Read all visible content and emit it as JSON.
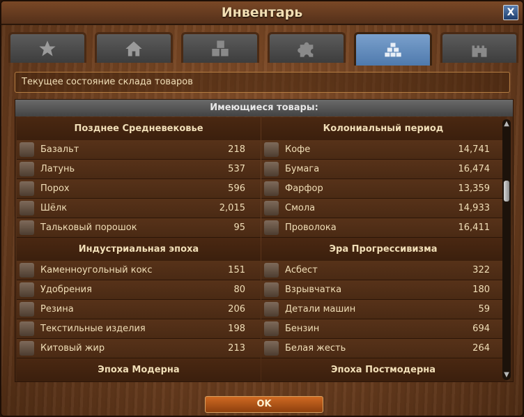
{
  "window": {
    "title": "Инвентарь",
    "close_label": "X"
  },
  "tabs": [
    {
      "icon": "star-icon"
    },
    {
      "icon": "house-icon"
    },
    {
      "icon": "crates-icon"
    },
    {
      "icon": "puzzle-icon"
    },
    {
      "icon": "goods-stack-icon",
      "active": true
    },
    {
      "icon": "castle-icon"
    }
  ],
  "info": "Текущее состояние склада товаров",
  "panel": {
    "header": "Имеющиеся товары:"
  },
  "left_column": {
    "eras": [
      {
        "name": "Позднее Средневековье",
        "items": [
          {
            "name": "Базальт",
            "value": "218",
            "icon": "basalt-icon"
          },
          {
            "name": "Латунь",
            "value": "537",
            "icon": "brass-icon"
          },
          {
            "name": "Порох",
            "value": "596",
            "icon": "gunpowder-icon"
          },
          {
            "name": "Шёлк",
            "value": "2,015",
            "icon": "silk-icon"
          },
          {
            "name": "Тальковый порошок",
            "value": "95",
            "icon": "talc-powder-icon"
          }
        ]
      },
      {
        "name": "Индустриальная эпоха",
        "items": [
          {
            "name": "Каменноугольный кокс",
            "value": "151",
            "icon": "coke-icon"
          },
          {
            "name": "Удобрения",
            "value": "80",
            "icon": "fertilizer-icon"
          },
          {
            "name": "Резина",
            "value": "206",
            "icon": "rubber-icon"
          },
          {
            "name": "Текстильные изделия",
            "value": "198",
            "icon": "textiles-icon"
          },
          {
            "name": "Китовый жир",
            "value": "213",
            "icon": "whale-oil-icon"
          }
        ]
      },
      {
        "name": "Эпоха Модерна",
        "items": []
      }
    ]
  },
  "right_column": {
    "eras": [
      {
        "name": "Колониальный период",
        "items": [
          {
            "name": "Кофе",
            "value": "14,741",
            "icon": "coffee-icon"
          },
          {
            "name": "Бумага",
            "value": "16,474",
            "icon": "paper-icon"
          },
          {
            "name": "Фарфор",
            "value": "13,359",
            "icon": "porcelain-icon"
          },
          {
            "name": "Смола",
            "value": "14,933",
            "icon": "tar-icon"
          },
          {
            "name": "Проволока",
            "value": "16,411",
            "icon": "wire-icon"
          }
        ]
      },
      {
        "name": "Эра Прогрессивизма",
        "items": [
          {
            "name": "Асбест",
            "value": "322",
            "icon": "asbestos-icon"
          },
          {
            "name": "Взрывчатка",
            "value": "180",
            "icon": "explosives-icon"
          },
          {
            "name": "Детали машин",
            "value": "59",
            "icon": "machine-parts-icon"
          },
          {
            "name": "Бензин",
            "value": "694",
            "icon": "petroleum-icon"
          },
          {
            "name": "Белая жесть",
            "value": "264",
            "icon": "tinplate-icon"
          }
        ]
      },
      {
        "name": "Эпоха Постмодерна",
        "items": []
      }
    ]
  },
  "buttons": {
    "ok": "OK"
  }
}
